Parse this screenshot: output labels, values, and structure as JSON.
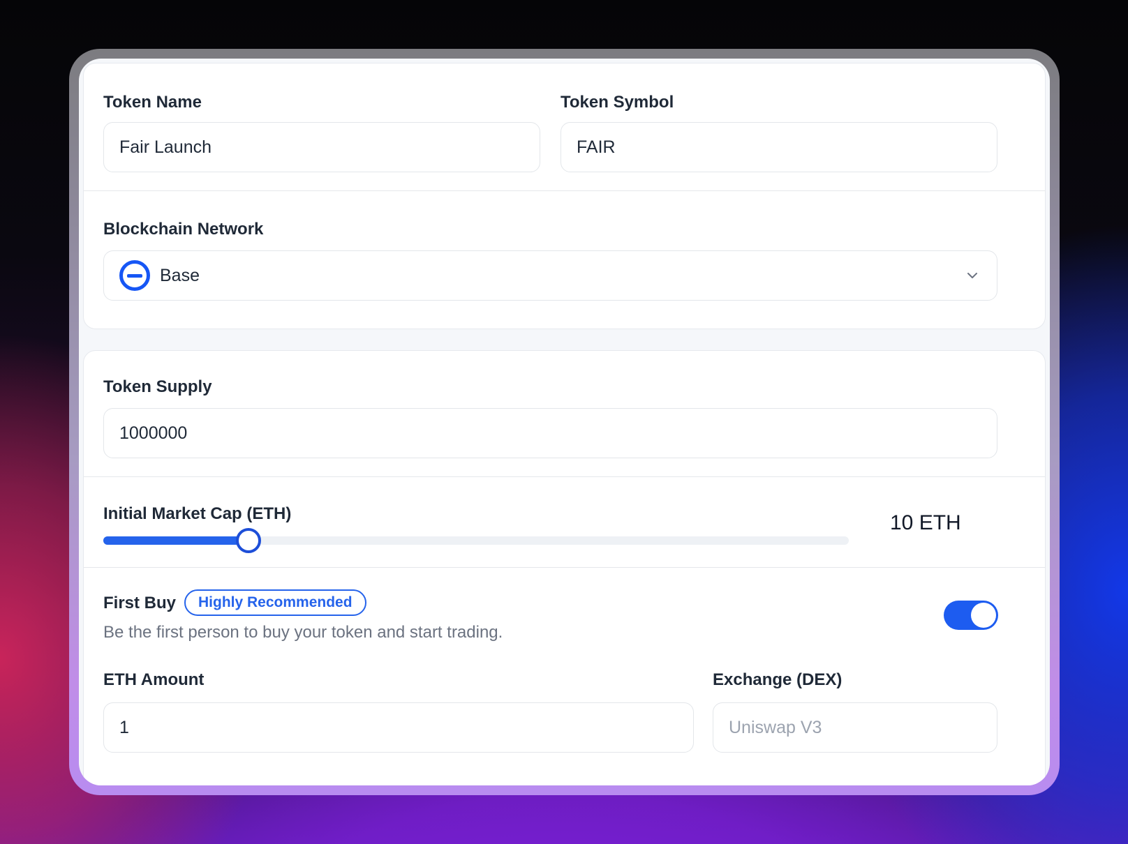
{
  "token_name": {
    "label": "Token Name",
    "value": "Fair Launch"
  },
  "token_symbol": {
    "label": "Token Symbol",
    "value": "FAIR"
  },
  "network": {
    "label": "Blockchain Network",
    "selected": "Base",
    "icon": "base-network-icon",
    "accent": "#1656f5"
  },
  "supply": {
    "label": "Token Supply",
    "value": "1000000"
  },
  "market_cap": {
    "label": "Initial Market Cap (ETH)",
    "value_label": "10 ETH",
    "slider_fraction": 0.195
  },
  "first_buy": {
    "label": "First Buy",
    "badge": "Highly Recommended",
    "description": "Be the first person to buy your token and start trading.",
    "enabled": true
  },
  "eth_amount": {
    "label": "ETH Amount",
    "value": "1"
  },
  "exchange": {
    "label": "Exchange (DEX)",
    "placeholder": "Uniswap V3"
  },
  "colors": {
    "accent": "#2563eb",
    "toggle_on": "#1d5cf0"
  }
}
